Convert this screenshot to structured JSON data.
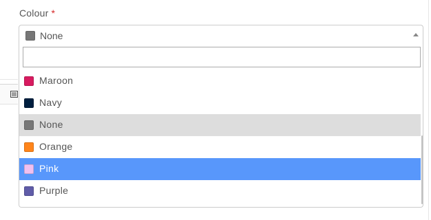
{
  "field": {
    "label": "Colour",
    "required_mark": "*"
  },
  "select": {
    "selected_label": "None",
    "selected_color": "#777777"
  },
  "search": {
    "value": "",
    "placeholder": ""
  },
  "options": [
    {
      "label": "Maroon",
      "color": "#d81b60",
      "state": "normal"
    },
    {
      "label": "Navy",
      "color": "#001f3f",
      "state": "normal"
    },
    {
      "label": "None",
      "color": "#777777",
      "state": "selected"
    },
    {
      "label": "Orange",
      "color": "#ff851b",
      "state": "normal"
    },
    {
      "label": "Pink",
      "color": "#f0c0f0",
      "state": "highlighted"
    },
    {
      "label": "Purple",
      "color": "#605ca8",
      "state": "normal"
    }
  ],
  "colors": {
    "highlight": "#5897fb",
    "selected_background": "#dddddd",
    "required": "#d62828"
  },
  "icons": {
    "dropdown_arrow": "arrow-up-icon",
    "toolbar": "list-icon"
  }
}
